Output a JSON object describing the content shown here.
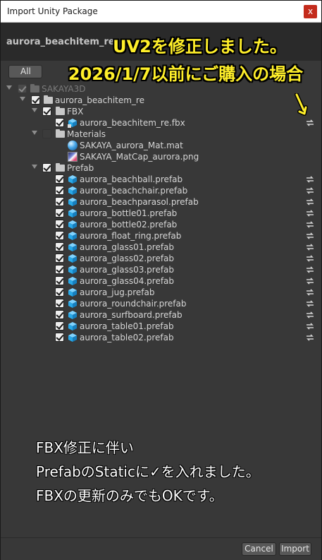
{
  "window": {
    "title": "Import Unity Package",
    "close_glyph": "x"
  },
  "package": {
    "name": "aurora_beachitem_re"
  },
  "toolbar": {
    "all_label": "All"
  },
  "tree": {
    "root": "SAKAYA3D",
    "folder": "aurora_beachitem_re",
    "fbx_folder": "FBX",
    "fbx_file": "aurora_beachitem_re.fbx",
    "materials_folder": "Materials",
    "materials": [
      "SAKAYA_aurora_Mat.mat",
      "SAKAYA_MatCap_aurora.png"
    ],
    "prefab_folder": "Prefab",
    "prefabs": [
      "aurora_beachball.prefab",
      "aurora_beachchair.prefab",
      "aurora_beachparasol.prefab",
      "aurora_bottle01.prefab",
      "aurora_bottle02.prefab",
      "aurora_float_ring.prefab",
      "aurora_glass01.prefab",
      "aurora_glass02.prefab",
      "aurora_glass03.prefab",
      "aurora_glass04.prefab",
      "aurora_jug.prefab",
      "aurora_roundchair.prefab",
      "aurora_surfboard.prefab",
      "aurora_table01.prefab",
      "aurora_table02.prefab"
    ]
  },
  "overlay": {
    "line1": "UV2を修正しました。",
    "line2": "2026/1/7以前にご購入の場合",
    "note1": "FBX修正に伴い",
    "note2": "PrefabのStaticに✓を入れました。",
    "note3": "FBXの更新のみでもOKです。"
  },
  "footer": {
    "cancel_label": "Cancel",
    "import_label": "Import"
  },
  "colors": {
    "accent_yellow": "#ffef2a",
    "close_red": "#c42b1c",
    "cube_blue": "#29a9e8"
  }
}
